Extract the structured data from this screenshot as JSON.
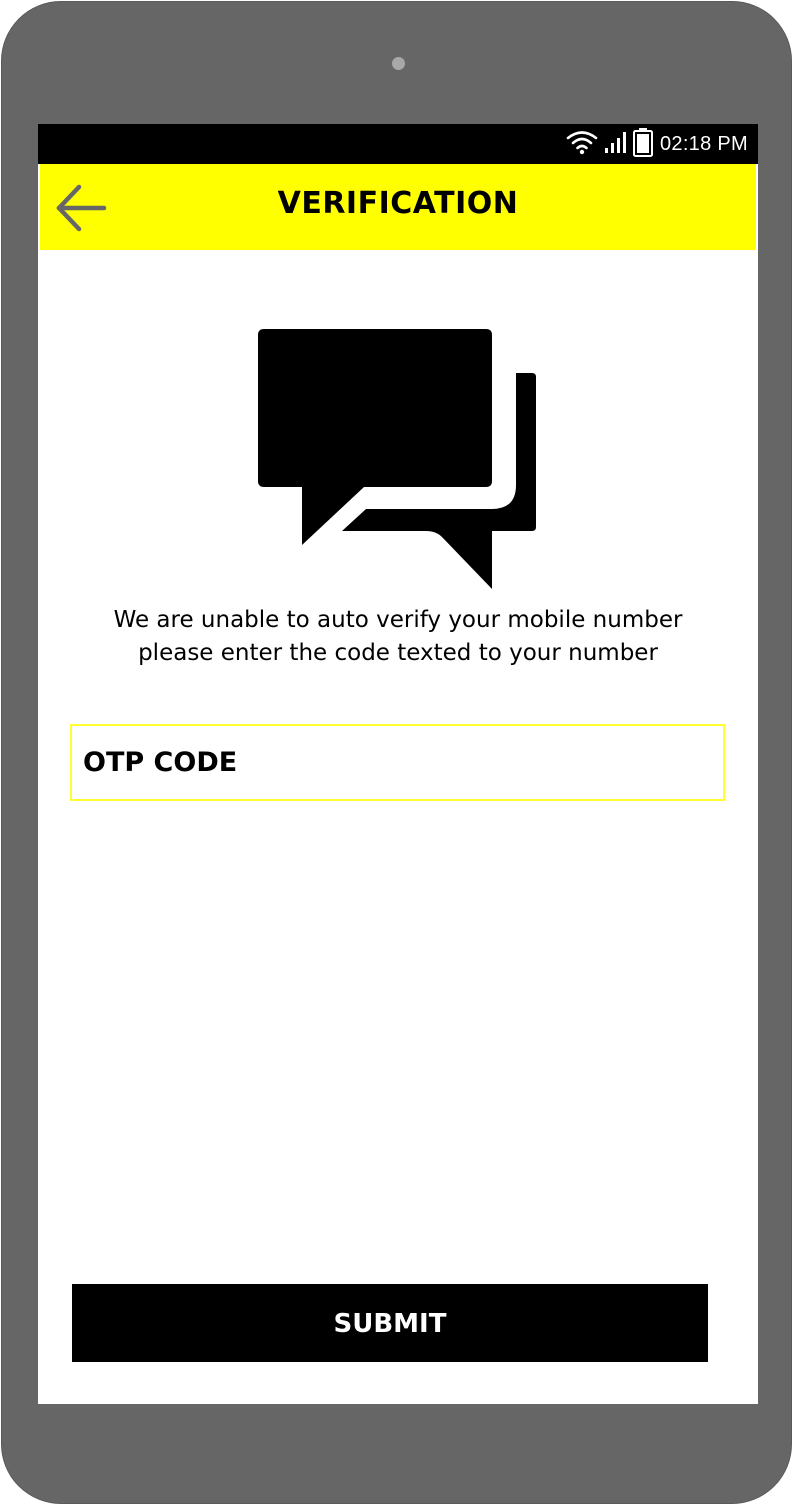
{
  "status_bar": {
    "time": "02:18 PM",
    "icons": [
      "wifi-icon",
      "signal-icon",
      "battery-icon"
    ]
  },
  "app_bar": {
    "title": "VERIFICATION",
    "back_icon": "arrow-left-icon",
    "background_color": "#ffff00"
  },
  "main": {
    "illustration_icon": "chat-bubbles-icon",
    "message_line_1": "We are unable to auto verify your mobile number",
    "message_line_2": "please enter the code texted to your number",
    "otp_input": {
      "placeholder": "OTP CODE",
      "value": "",
      "border_color": "#ffff33"
    }
  },
  "footer": {
    "submit_label": "SUBMIT",
    "submit_color": "#000000"
  }
}
